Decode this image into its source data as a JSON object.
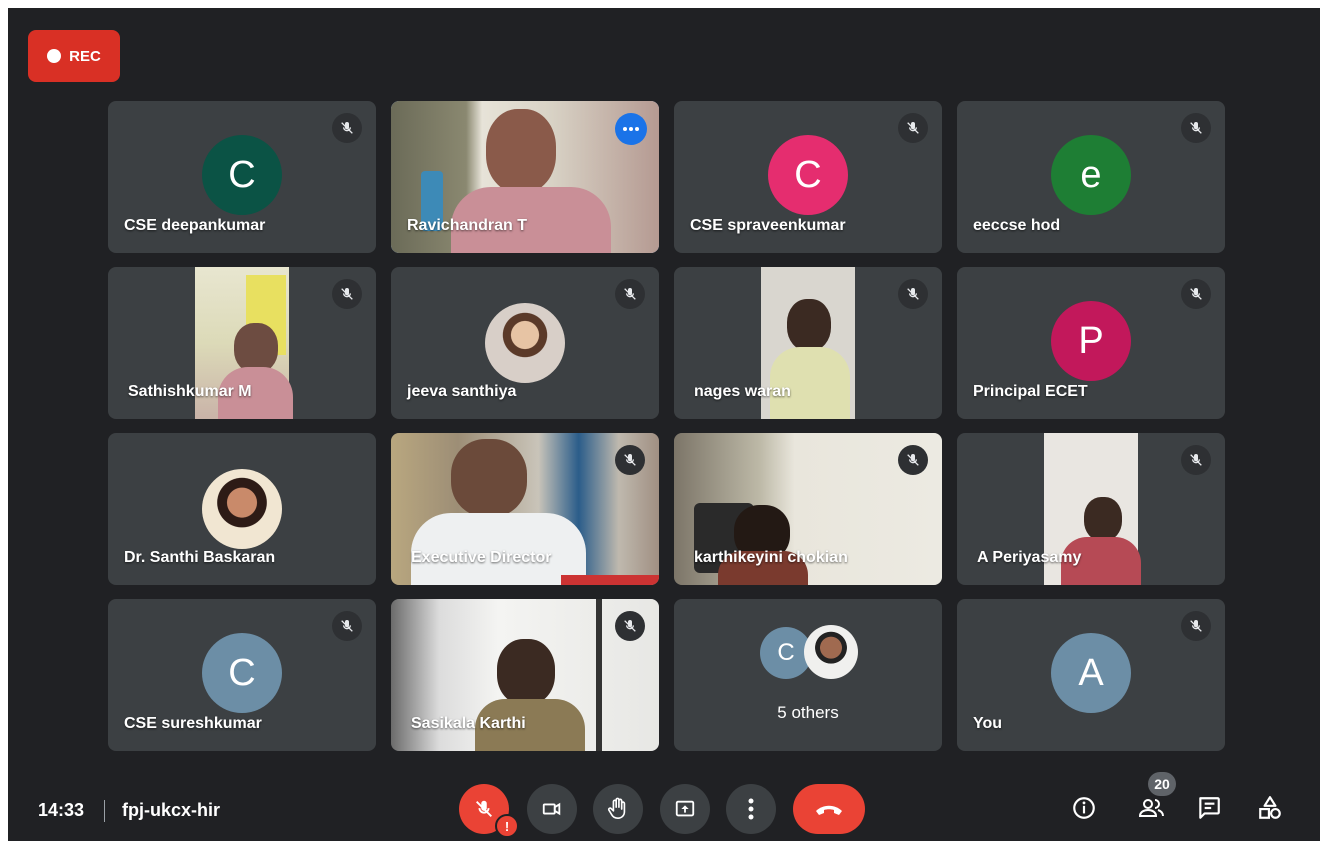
{
  "recording": {
    "label": "REC"
  },
  "participants": [
    {
      "name": "CSE deepankumar",
      "initial": "C",
      "color": "#0b5345"
    },
    {
      "name": "Ravichandran T"
    },
    {
      "name": "CSE spraveenkumar",
      "initial": "C",
      "color": "#e52d6f"
    },
    {
      "name": "eeccse hod",
      "initial": "e",
      "color": "#1e7e34"
    },
    {
      "name": "Sathishkumar M"
    },
    {
      "name": "jeeva santhiya"
    },
    {
      "name": "nages waran"
    },
    {
      "name": "Principal ECET",
      "initial": "P",
      "color": "#c2185b"
    },
    {
      "name": "Dr. Santhi Baskaran"
    },
    {
      "name": "Executive Director"
    },
    {
      "name": "karthikeyini chokian"
    },
    {
      "name": "A Periyasamy"
    },
    {
      "name": "CSE sureshkumar",
      "initial": "C",
      "color": "#6c8ea6"
    },
    {
      "name": "Sasikala Karthi"
    },
    {
      "others_label": "5 others",
      "initial": "C",
      "color": "#6c8ea6"
    },
    {
      "name": "You",
      "initial": "A",
      "color": "#6c8ea6"
    }
  ],
  "meeting": {
    "time": "14:33",
    "code": "fpj-ukcx-hir"
  },
  "controls": {
    "mic_icon": "mic-off-icon",
    "mic_warning": "!",
    "camera_icon": "camera-off-icon",
    "hand_icon": "raise-hand-icon",
    "present_icon": "present-screen-icon",
    "more_icon": "more-vert-icon",
    "hangup_icon": "call-end-icon"
  },
  "right_panel": {
    "people_count": "20"
  },
  "colors": {
    "background": "#202124",
    "tile": "#3c4043",
    "danger": "#ea4335",
    "active_outline": "#8ab4f8",
    "accent": "#1a73e8"
  }
}
